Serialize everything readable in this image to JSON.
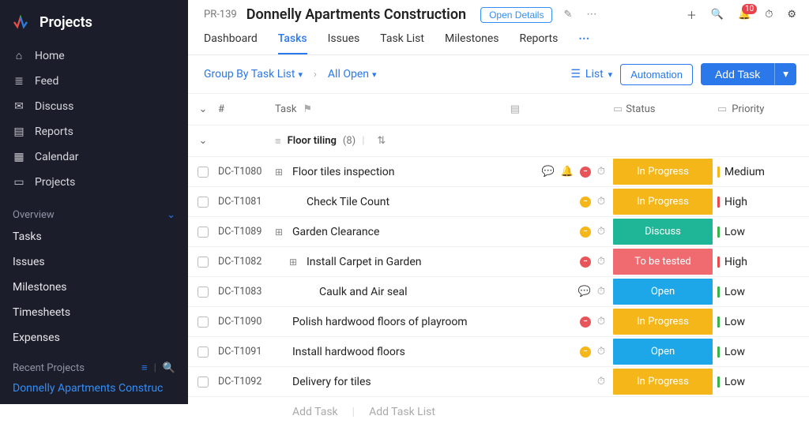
{
  "brand": {
    "title": "Projects"
  },
  "sidebar": {
    "items": [
      {
        "icon": "home-icon",
        "label": "Home"
      },
      {
        "icon": "feed-icon",
        "label": "Feed"
      },
      {
        "icon": "discuss-icon",
        "label": "Discuss"
      },
      {
        "icon": "reports-icon",
        "label": "Reports"
      },
      {
        "icon": "calendar-icon",
        "label": "Calendar"
      },
      {
        "icon": "projects-icon",
        "label": "Projects"
      }
    ],
    "overview": {
      "header": "Overview",
      "items": [
        "Tasks",
        "Issues",
        "Milestones",
        "Timesheets",
        "Expenses"
      ]
    },
    "recent": {
      "header": "Recent Projects",
      "link": "Donnelly Apartments Construc"
    }
  },
  "header": {
    "code": "PR-139",
    "name": "Donnelly Apartments Construction",
    "open_details": "Open Details",
    "notif_count": "10"
  },
  "tabs": [
    "Dashboard",
    "Tasks",
    "Issues",
    "Task List",
    "Milestones",
    "Reports"
  ],
  "tabs_active_index": 1,
  "toolbar": {
    "group_by": "Group By Task List",
    "filter": "All Open",
    "view": "List",
    "automation": "Automation",
    "add_task": "Add Task"
  },
  "columns": {
    "id": "#",
    "task": "Task",
    "status": "Status",
    "priority": "Priority"
  },
  "group": {
    "name": "Floor tiling",
    "count": "(8)"
  },
  "rows": [
    {
      "id": "DC-T1080",
      "name": "Floor tiles inspection",
      "indent": 0,
      "icon": "expand",
      "actions": [
        "comment",
        "bell",
        "red",
        "timer"
      ],
      "status": "In Progress",
      "status_cls": "st-inprogress",
      "priority": "Medium",
      "priority_cls": "prio-medium"
    },
    {
      "id": "DC-T1081",
      "name": "Check Tile Count",
      "indent": 1,
      "icon": "",
      "actions": [
        "yellow",
        "timer"
      ],
      "status": "In Progress",
      "status_cls": "st-inprogress",
      "priority": "High",
      "priority_cls": "prio-high"
    },
    {
      "id": "DC-T1089",
      "name": "Garden Clearance",
      "indent": 0,
      "icon": "expand",
      "actions": [
        "yellow",
        "timer"
      ],
      "status": "Discuss",
      "status_cls": "st-discuss",
      "priority": "Low",
      "priority_cls": "prio-low"
    },
    {
      "id": "DC-T1082",
      "name": "Install Carpet in Garden",
      "indent": 1,
      "icon": "expand",
      "actions": [
        "red",
        "timer"
      ],
      "status": "To be tested",
      "status_cls": "st-tobetested",
      "priority": "High",
      "priority_cls": "prio-high"
    },
    {
      "id": "DC-T1083",
      "name": "Caulk and Air seal",
      "indent": 2,
      "icon": "",
      "actions": [
        "comment",
        "timer"
      ],
      "status": "Open",
      "status_cls": "st-open",
      "priority": "Low",
      "priority_cls": "prio-low"
    },
    {
      "id": "DC-T1090",
      "name": "Polish hardwood floors of playroom",
      "indent": 0,
      "icon": "",
      "actions": [
        "red",
        "timer"
      ],
      "status": "In Progress",
      "status_cls": "st-inprogress",
      "priority": "Low",
      "priority_cls": "prio-low"
    },
    {
      "id": "DC-T1091",
      "name": "Install hardwood floors",
      "indent": 0,
      "icon": "",
      "actions": [
        "yellow",
        "timer"
      ],
      "status": "Open",
      "status_cls": "st-open",
      "priority": "Low",
      "priority_cls": "prio-low"
    },
    {
      "id": "DC-T1092",
      "name": "Delivery for tiles",
      "indent": 0,
      "icon": "",
      "actions": [
        "timer"
      ],
      "status": "In Progress",
      "status_cls": "st-inprogress",
      "priority": "Low",
      "priority_cls": "prio-low"
    }
  ],
  "footer": {
    "add_task": "Add Task",
    "add_task_list": "Add Task List"
  }
}
